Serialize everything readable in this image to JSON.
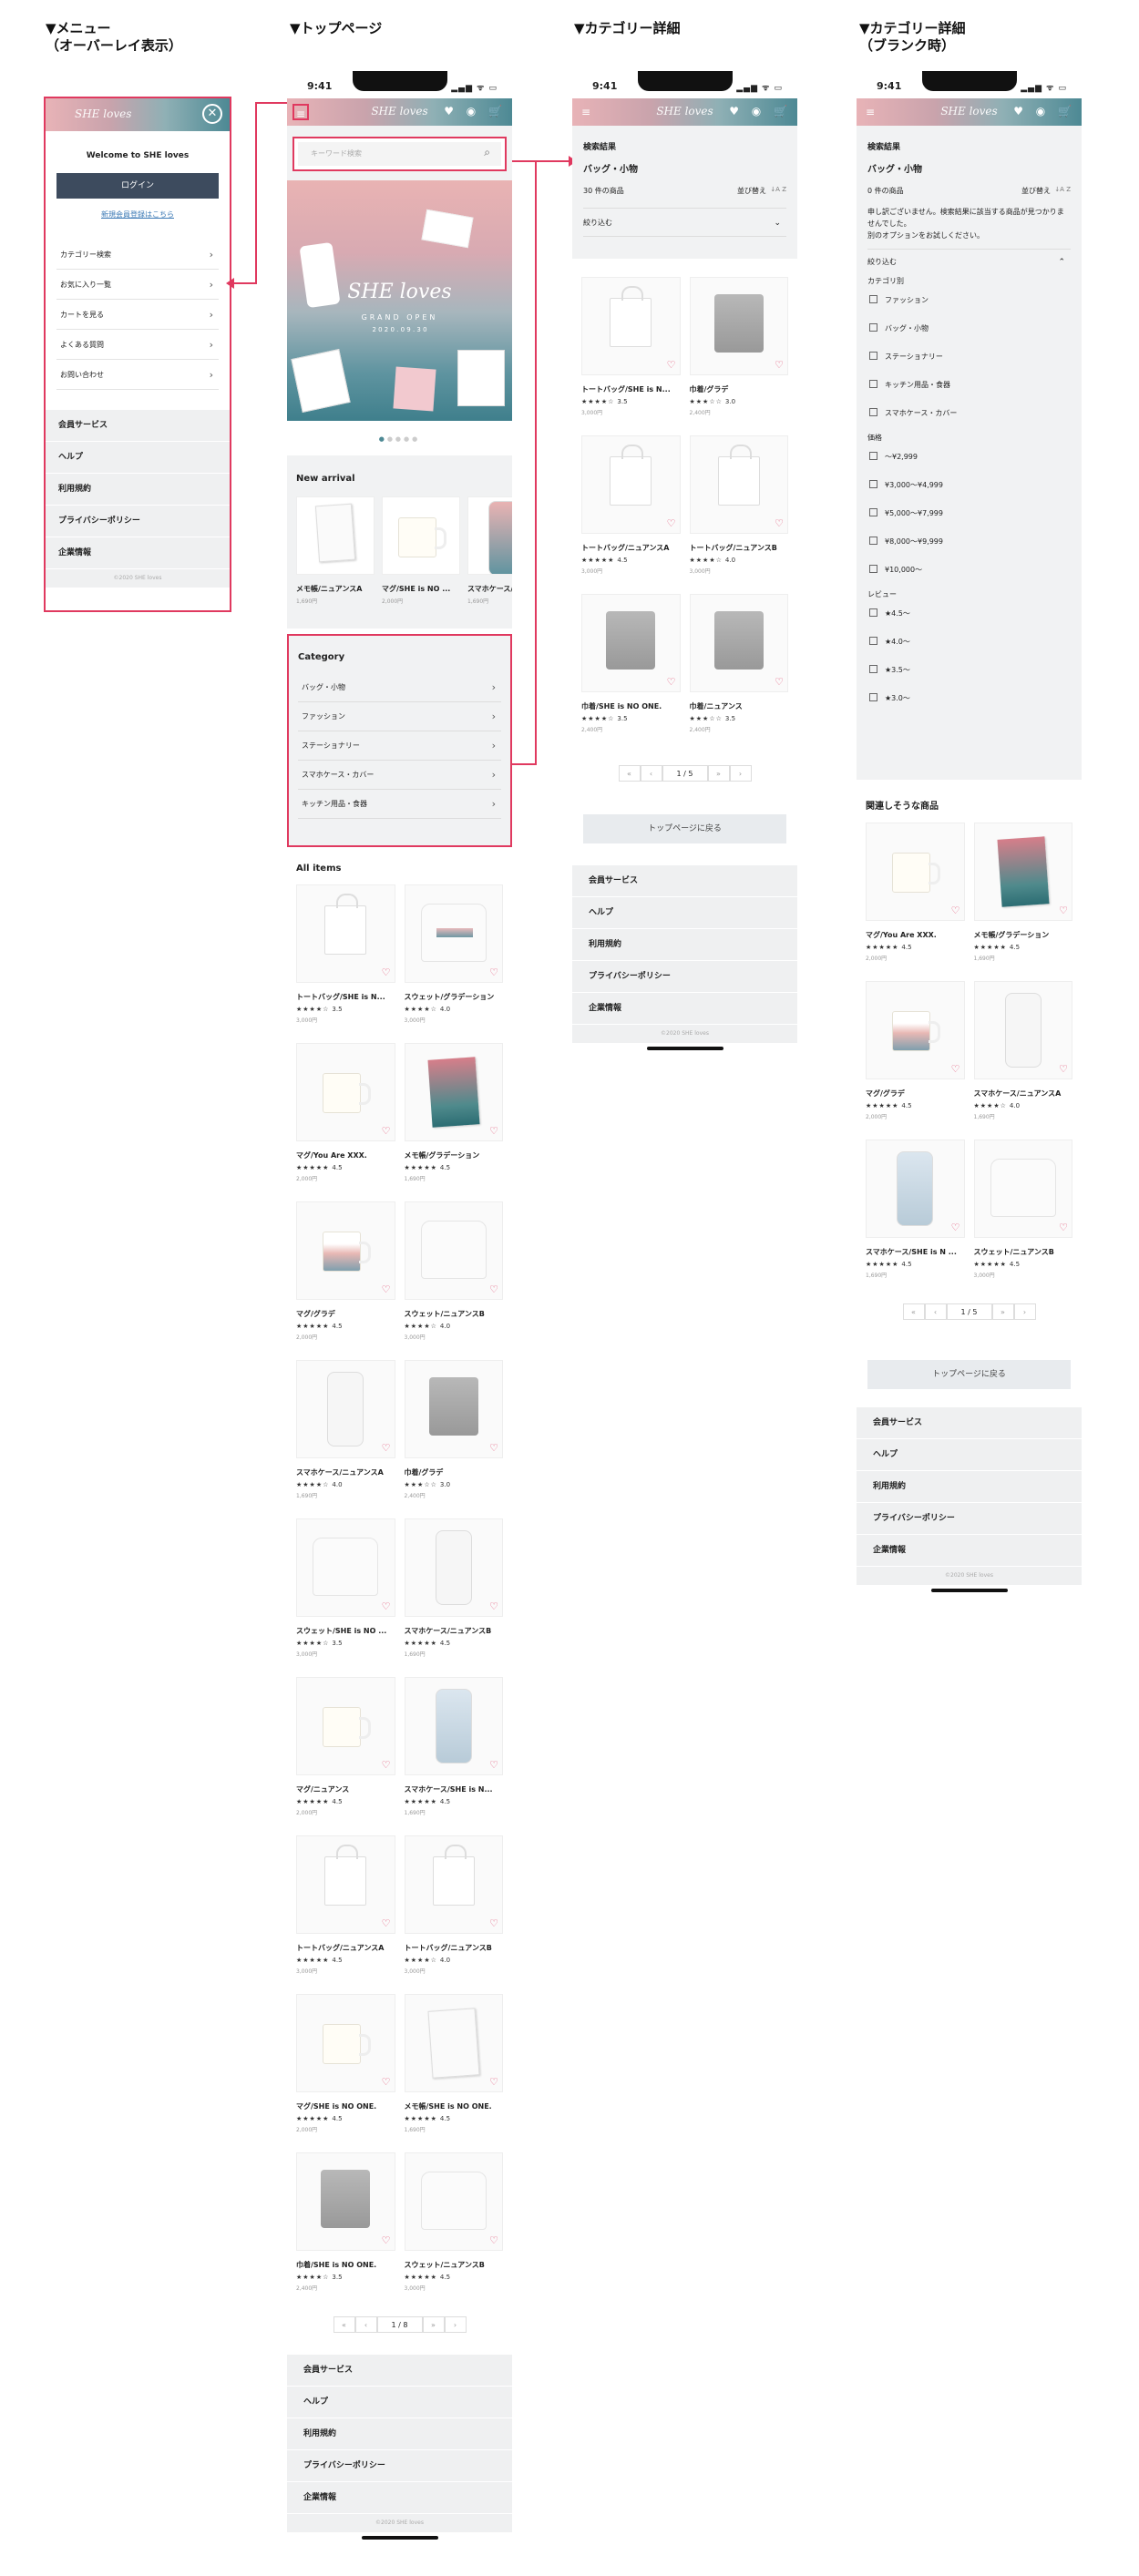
{
  "columns": {
    "menu": "▼メニュー\n（オーバーレイ表示）",
    "top": "▼トップページ",
    "category": "▼カテゴリー詳細",
    "category_blank": "▼カテゴリー詳細\n（ブランク時）"
  },
  "status_time": "9:41",
  "status_icons": "▂▄▆ ᯤ ▭",
  "logo": "SHE loves",
  "header_icons": "♥ ◉ 🛒",
  "menu_overlay": {
    "welcome": "Welcome to SHE loves",
    "login": "ログイン",
    "register": "新規会員登録はこちら",
    "items": [
      "カテゴリー検索",
      "お気に入り一覧",
      "カートを見る",
      "よくある質問",
      "お問い合わせ"
    ]
  },
  "footer": {
    "items": [
      "会員サービス",
      "ヘルプ",
      "利用規約",
      "プライバシーポリシー",
      "企業情報"
    ],
    "copy": "©2020 SHE loves"
  },
  "top": {
    "search_placeholder": "キーワード検索",
    "hero": {
      "brand": "SHE loves",
      "sub": "GRAND OPEN",
      "date": "2 0 2 0 . 0 9 . 3 0"
    },
    "new_arrival": "New arrival",
    "new_items": [
      {
        "name": "メモ帳/ニュアンスA",
        "price": "1,690円"
      },
      {
        "name": "マグ/SHE is NO ...",
        "price": "2,000円"
      },
      {
        "name": "スマホケース/XC",
        "price": "1,690円"
      }
    ],
    "category_title": "Category",
    "categories": [
      "バッグ・小物",
      "ファッション",
      "ステーショナリー",
      "スマホケース・カバー",
      "キッチン用品・食器"
    ],
    "all_items": "All items",
    "products": [
      {
        "name": "トートバッグ/SHE is N...",
        "stars": "★★★★☆",
        "rating": "3.5",
        "price": "3,000円",
        "art": "tote"
      },
      {
        "name": "スウェット/グラデーション",
        "stars": "★★★★☆",
        "rating": "4.0",
        "price": "3,000円",
        "art": "sweat grad"
      },
      {
        "name": "マグ/You Are XXX.",
        "stars": "★★★★★",
        "rating": "4.5",
        "price": "2,000円",
        "art": "mug"
      },
      {
        "name": "メモ帳/グラデーション",
        "stars": "★★★★★",
        "rating": "4.5",
        "price": "1,690円",
        "art": "note"
      },
      {
        "name": "マグ/グラデ",
        "stars": "★★★★★",
        "rating": "4.5",
        "price": "2,000円",
        "art": "mug grad"
      },
      {
        "name": "スウェット/ニュアンスB",
        "stars": "★★★★☆",
        "rating": "4.0",
        "price": "3,000円",
        "art": "sweat"
      },
      {
        "name": "スマホケース/ニュアンスA",
        "stars": "★★★★☆",
        "rating": "4.0",
        "price": "1,690円",
        "art": "case"
      },
      {
        "name": "巾着/グラデ",
        "stars": "★★★☆☆",
        "rating": "3.0",
        "price": "2,400円",
        "art": "pouch"
      },
      {
        "name": "スウェット/SHE is NO ...",
        "stars": "★★★★☆",
        "rating": "3.5",
        "price": "3,000円",
        "art": "sweat"
      },
      {
        "name": "スマホケース/ニュアンスB",
        "stars": "★★★★★",
        "rating": "4.5",
        "price": "1,690円",
        "art": "case"
      },
      {
        "name": "マグ/ニュアンス",
        "stars": "★★★★★",
        "rating": "4.5",
        "price": "2,000円",
        "art": "mug"
      },
      {
        "name": "スマホケース/SHE is N...",
        "stars": "★★★★★",
        "rating": "4.5",
        "price": "1,690円",
        "art": "case blue"
      },
      {
        "name": "トートバッグ/ニュアンスA",
        "stars": "★★★★★",
        "rating": "4.5",
        "price": "3,000円",
        "art": "tote"
      },
      {
        "name": "トートバッグ/ニュアンスB",
        "stars": "★★★★☆",
        "rating": "4.0",
        "price": "3,000円",
        "art": "tote"
      },
      {
        "name": "マグ/SHE is NO ONE.",
        "stars": "★★★★★",
        "rating": "4.5",
        "price": "2,000円",
        "art": "mug"
      },
      {
        "name": "メモ帳/SHE is NO ONE.",
        "stars": "★★★★★",
        "rating": "4.5",
        "price": "1,690円",
        "art": "note white"
      },
      {
        "name": "巾着/SHE is NO ONE.",
        "stars": "★★★★☆",
        "rating": "3.5",
        "price": "2,400円",
        "art": "pouch"
      },
      {
        "name": "スウェット/ニュアンスB",
        "stars": "★★★★★",
        "rating": "4.5",
        "price": "3,000円",
        "art": "sweat"
      }
    ],
    "pager": [
      "«",
      "‹",
      "1 / 8",
      "»",
      "›"
    ]
  },
  "category": {
    "results_label": "検索結果",
    "category_name": "バッグ・小物",
    "count": "30 件の商品",
    "sort": "並び替え",
    "sort_icon": "↓A Z",
    "filter": "絞り込む",
    "products": [
      {
        "name": "トートバッグ/SHE is N...",
        "stars": "★★★★☆",
        "rating": "3.5",
        "price": "3,000円",
        "art": "tote"
      },
      {
        "name": "巾着/グラデ",
        "stars": "★★★☆☆",
        "rating": "3.0",
        "price": "2,400円",
        "art": "pouch"
      },
      {
        "name": "トートバッグ/ニュアンスA",
        "stars": "★★★★★",
        "rating": "4.5",
        "price": "3,000円",
        "art": "tote"
      },
      {
        "name": "トートバッグ/ニュアンスB",
        "stars": "★★★★☆",
        "rating": "4.0",
        "price": "3,000円",
        "art": "tote"
      },
      {
        "name": "巾着/SHE is NO ONE.",
        "stars": "★★★★☆",
        "rating": "3.5",
        "price": "2,400円",
        "art": "pouch"
      },
      {
        "name": "巾着/ニュアンス",
        "stars": "★★★☆☆",
        "rating": "3.5",
        "price": "2,400円",
        "art": "pouch"
      }
    ],
    "pager": [
      "«",
      "‹",
      "1 / 5",
      "»",
      "›"
    ],
    "back": "トップページに戻る"
  },
  "blank": {
    "results_label": "検索結果",
    "category_name": "バッグ・小物",
    "count": "0 件の商品",
    "sort": "並び替え",
    "sort_icon": "↓A Z",
    "message": "申し訳ございません。検索結果に該当する商品が見つかりませんでした。\n別のオプションをお試しください。",
    "filter": "絞り込む",
    "cat_label": "カテゴリ別",
    "cats": [
      "ファッション",
      "バッグ・小物",
      "ステーショナリー",
      "キッチン用品・食器",
      "スマホケース・カバー"
    ],
    "price_label": "価格",
    "prices": [
      "～¥2,999",
      "¥3,000～¥4,999",
      "¥5,000～¥7,999",
      "¥8,000～¥9,999",
      "¥10,000～"
    ],
    "review_label": "レビュー",
    "reviews": [
      "★4.5～",
      "★4.0～",
      "★3.5～",
      "★3.0～"
    ],
    "related": "関連しそうな商品",
    "products": [
      {
        "name": "マグ/You Are XXX.",
        "stars": "★★★★★",
        "rating": "4.5",
        "price": "2,000円",
        "art": "mug"
      },
      {
        "name": "メモ帳/グラデーション",
        "stars": "★★★★★",
        "rating": "4.5",
        "price": "1,690円",
        "art": "note"
      },
      {
        "name": "マグ/グラデ",
        "stars": "★★★★★",
        "rating": "4.5",
        "price": "2,000円",
        "art": "mug grad"
      },
      {
        "name": "スマホケース/ニュアンスA",
        "stars": "★★★★☆",
        "rating": "4.0",
        "price": "1,690円",
        "art": "case"
      },
      {
        "name": "スマホケース/SHE is N ...",
        "stars": "★★★★★",
        "rating": "4.5",
        "price": "1,690円",
        "art": "case blue"
      },
      {
        "name": "スウェット/ニュアンスB",
        "stars": "★★★★★",
        "rating": "4.5",
        "price": "3,000円",
        "art": "sweat"
      }
    ],
    "pager": [
      "«",
      "‹",
      "1 / 5",
      "»",
      "›"
    ],
    "back": "トップページに戻る"
  }
}
